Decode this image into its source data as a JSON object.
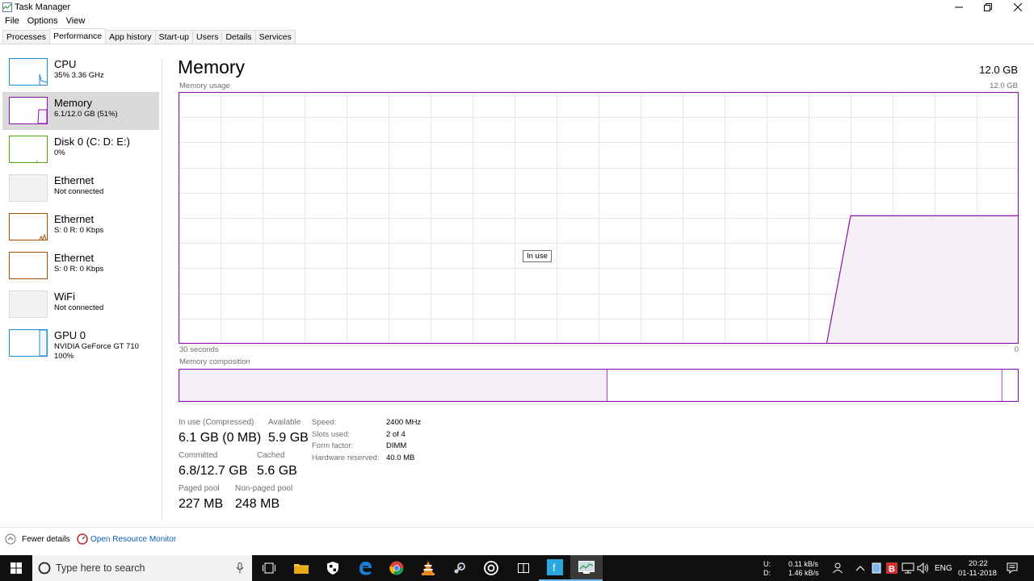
{
  "window": {
    "title": "Task Manager",
    "minimize_icon": "minimize-icon",
    "restore_icon": "restore-icon",
    "close_icon": "close-icon"
  },
  "menu": [
    "File",
    "Options",
    "View"
  ],
  "tabs": [
    "Processes",
    "Performance",
    "App history",
    "Start-up",
    "Users",
    "Details",
    "Services"
  ],
  "sidebar": [
    {
      "name": "CPU",
      "sub": "35% 3.36 GHz",
      "color": "#1c8ad6"
    },
    {
      "name": "Memory",
      "sub": "6.1/12.0 GB (51%)",
      "color": "#8b12ae"
    },
    {
      "name": "Disk 0 (C: D: E:)",
      "sub": "0%",
      "color": "#4da60c"
    },
    {
      "name": "Ethernet",
      "sub": "Not connected",
      "color": "#a7a7a7"
    },
    {
      "name": "Ethernet",
      "sub": "S: 0 R: 0 Kbps",
      "color": "#a74f01"
    },
    {
      "name": "Ethernet",
      "sub": "S: 0 R: 0 Kbps",
      "color": "#a74f01"
    },
    {
      "name": "WiFi",
      "sub": "Not connected",
      "color": "#a7a7a7"
    },
    {
      "name": "GPU 0",
      "sub": "NVIDIA GeForce GT 710",
      "sub2": "100%",
      "color": "#1c8ad6"
    }
  ],
  "main": {
    "title": "Memory",
    "capacity": "12.0 GB",
    "usage_label": "Memory usage",
    "usage_max": "12.0 GB",
    "time_label": "30 seconds",
    "time_min": "0",
    "tooltip": "In use",
    "composition_label": "Memory composition",
    "accent": "#8b12ae",
    "stats": {
      "in_use_label": "In use (Compressed)",
      "in_use": "6.1 GB (0 MB)",
      "available_label": "Available",
      "available": "5.9 GB",
      "committed_label": "Committed",
      "committed": "6.8/12.7 GB",
      "cached_label": "Cached",
      "cached": "5.6 GB",
      "paged_label": "Paged pool",
      "paged": "227 MB",
      "nonpaged_label": "Non-paged pool",
      "nonpaged": "248 MB"
    },
    "specs": {
      "speed_label": "Speed:",
      "speed": "2400 MHz",
      "slots_label": "Slots used:",
      "slots": "2 of 4",
      "form_label": "Form factor:",
      "form": "DIMM",
      "reserved_label": "Hardware reserved:",
      "reserved": "40.0 MB"
    }
  },
  "chart_data": {
    "type": "area",
    "title": "Memory usage",
    "ylabel": "",
    "ylim": [
      0,
      12.0
    ],
    "x": [
      60,
      58,
      56,
      54,
      52,
      50,
      48,
      46,
      44,
      42,
      40,
      38,
      36,
      34,
      32,
      30,
      28,
      26,
      24,
      22,
      20,
      18,
      16,
      14,
      12,
      10,
      8,
      6,
      4,
      2,
      0
    ],
    "x_visible_label": "30 seconds",
    "series": [
      {
        "values": [
          null,
          null,
          null,
          null,
          null,
          null,
          null,
          null,
          null,
          null,
          null,
          null,
          null,
          null,
          null,
          null,
          null,
          null,
          null,
          null,
          null,
          null,
          null,
          null,
          null,
          null,
          null,
          0,
          6.1,
          6.1,
          6.1,
          6.1,
          6.1,
          6.1,
          6.1,
          6.1
        ]
      }
    ],
    "composition": {
      "in_use_fraction": 0.51,
      "modified_fraction": 0.0,
      "standby_fraction": 0.47,
      "free_fraction": 0.02
    }
  },
  "footer": {
    "fewer": "Fewer details",
    "monitor": "Open Resource Monitor"
  },
  "taskbar": {
    "search_placeholder": "Type here to search",
    "upload_label": "U:",
    "upload": "0.11 kB/s",
    "download_label": "D:",
    "download": "1.46 kB/s",
    "lang": "ENG",
    "time": "20:22",
    "date": "01-11-2018"
  }
}
